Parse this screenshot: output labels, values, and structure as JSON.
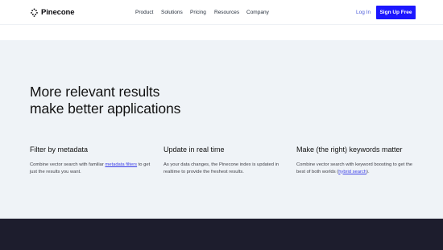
{
  "header": {
    "logo_text": "Pinecone",
    "nav": [
      "Product",
      "Solutions",
      "Pricing",
      "Resources",
      "Company"
    ],
    "login_label": "Log In",
    "signup_label": "Sign Up Free"
  },
  "hero": {
    "headline_line1": "More relevant results",
    "headline_line2": "make better applications"
  },
  "features": [
    {
      "title": "Filter by metadata",
      "text_before": "Combine vector search with familiar ",
      "link": "metadata filters",
      "text_after": " to get just the results you want."
    },
    {
      "title": "Update in real time",
      "text_before": "As your data changes, the Pinecone index is updated in realtime to provide the freshest results.",
      "link": "",
      "text_after": ""
    },
    {
      "title": "Make (the right) keywords matter",
      "text_before": "Combine vector search with keyword boosting to get the best of both worlds (",
      "link": "hybrid search",
      "text_after": ")."
    }
  ],
  "colors": {
    "accent": "#1c17ff",
    "band": "#eff3f7",
    "dark_band": "#1d1d2d",
    "link": "#3b3ee8"
  }
}
